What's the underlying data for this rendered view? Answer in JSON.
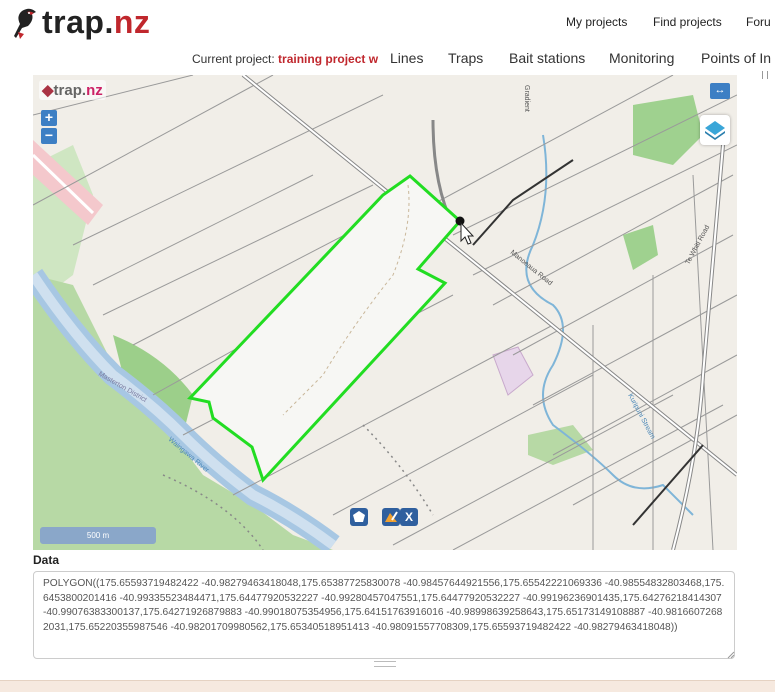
{
  "brand": {
    "name_main": "trap.",
    "name_accent": "nz"
  },
  "topnav": {
    "my_projects": "My projects",
    "find_projects": "Find projects",
    "forum": "Foru"
  },
  "project": {
    "label": "Current project:",
    "name": "training project w"
  },
  "tabs": [
    "Lines",
    "Traps",
    "Bait stations",
    "Monitoring",
    "Points of In"
  ],
  "map": {
    "watermark_main": "trap.",
    "watermark_accent": "nz",
    "zoom_in": "+",
    "zoom_out": "−",
    "scale": "500 m",
    "labels": {
      "manoeaua_road": "Manoeaua Road",
      "te_whiti_road": "Te Whiti Road",
      "kuripuni_stream": "Kuripuni Stream",
      "waingawa_river": "Waingawa River",
      "masterton_district": "Masterton District",
      "gradient_tag": "Gradient"
    },
    "tool_close": "X",
    "accent_color": "#22dd22"
  },
  "data_section": {
    "label": "Data",
    "text": "POLYGON((175.65593719482422 -40.98279463418048,175.65387725830078 -40.98457644921556,175.65542221069336 -40.98554832803468,175.6453800201416 -40.99335523484471,175.64477920532227 -40.99280457047551,175.64477920532227 -40.99196236901435,175.64276218414307 -40.99076383300137,175.64271926879883 -40.99018075354956,175.64151763916016 -40.98998639258643,175.65173149108887 -40.98166072682031,175.65220355987546 -40.98201709980562,175.65340518951413 -40.98091557708309,175.65593719482422 -40.98279463418048))"
  }
}
